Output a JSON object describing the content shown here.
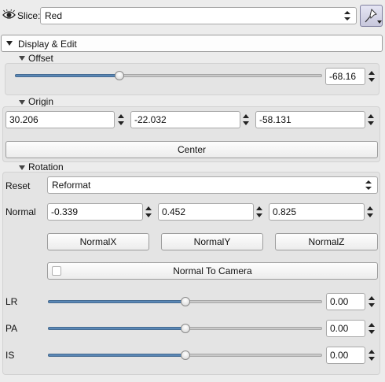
{
  "top_bar": {
    "slice_label": "Slice:",
    "slice_value": "Red"
  },
  "display_edit": {
    "header": "Display & Edit"
  },
  "offset": {
    "title": "Offset",
    "value": "-68.16",
    "slider_fraction": 0.34
  },
  "origin": {
    "title": "Origin",
    "x": "30.206",
    "y": "-22.032",
    "z": "-58.131",
    "center_button": "Center"
  },
  "rotation": {
    "title": "Rotation",
    "reset_label": "Reset",
    "reset_value": "Reformat",
    "normal_label": "Normal",
    "normal_x": "-0.339",
    "normal_y": "0.452",
    "normal_z": "0.825",
    "normalx_button": "NormalX",
    "normaly_button": "NormalY",
    "normalz_button": "NormalZ",
    "normal_to_camera_button": "Normal To Camera",
    "lr_label": "LR",
    "lr_value": "0.00",
    "lr_fraction": 0.5,
    "pa_label": "PA",
    "pa_value": "0.00",
    "pa_fraction": 0.5,
    "is_label": "IS",
    "is_value": "0.00",
    "is_fraction": 0.5
  },
  "icons": {
    "visibility": "eye-icon",
    "pin": "pin-icon",
    "dropdown": "chevron-down-icon"
  }
}
